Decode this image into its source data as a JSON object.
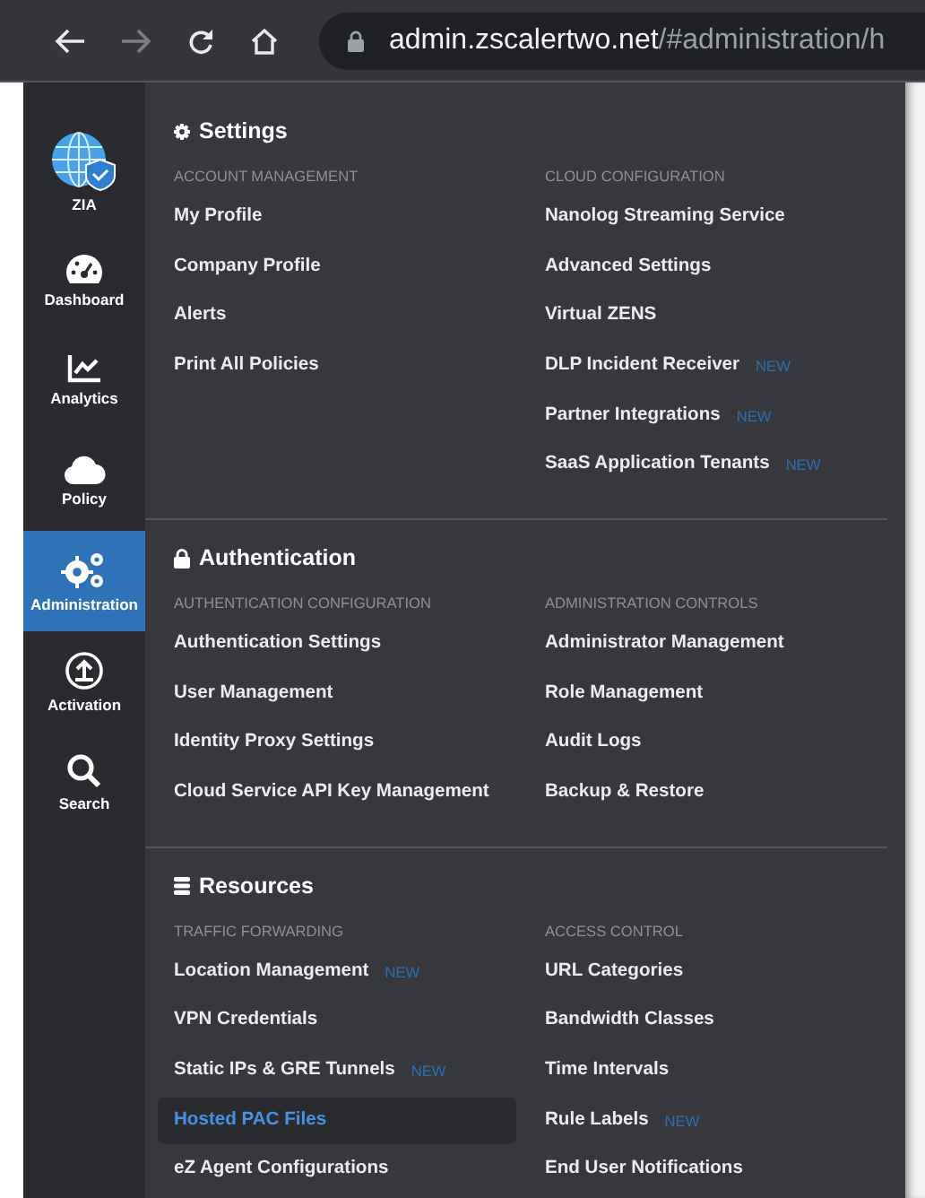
{
  "browser": {
    "nav": [
      {
        "kind": "back",
        "disabled": false
      },
      {
        "kind": "forward",
        "disabled": true
      },
      {
        "kind": "reload",
        "disabled": false
      },
      {
        "kind": "home",
        "disabled": false
      }
    ],
    "url_host": "admin.zscalertwo.net",
    "url_path": "/#administration/h"
  },
  "sidebar": {
    "items": [
      {
        "label": "ZIA",
        "selected": false
      },
      {
        "label": "Dashboard",
        "selected": false
      },
      {
        "label": "Analytics",
        "selected": false
      },
      {
        "label": "Policy",
        "selected": false
      },
      {
        "label": "Administration",
        "selected": true
      },
      {
        "label": "Activation",
        "selected": false
      },
      {
        "label": "Search",
        "selected": false
      }
    ]
  },
  "sections": [
    {
      "title": "Settings",
      "columns": [
        {
          "heading": "ACCOUNT MANAGEMENT",
          "items": [
            {
              "label": "My Profile",
              "selected": false
            },
            {
              "label": "Company Profile",
              "selected": false
            },
            {
              "label": "Alerts",
              "selected": false
            },
            {
              "label": "Print All Policies",
              "selected": false
            }
          ]
        },
        {
          "heading": "CLOUD CONFIGURATION",
          "items": [
            {
              "label": "Nanolog Streaming Service",
              "selected": false
            },
            {
              "label": "Advanced Settings",
              "selected": false
            },
            {
              "label": "Virtual ZENS",
              "selected": false
            },
            {
              "label": "DLP Incident Receiver",
              "selected": false,
              "badge": "NEW"
            },
            {
              "label": "Partner Integrations",
              "selected": false,
              "badge": "NEW"
            },
            {
              "label": "SaaS Application Tenants",
              "selected": false,
              "badge": "NEW"
            }
          ]
        }
      ]
    },
    {
      "title": "Authentication",
      "columns": [
        {
          "heading": "AUTHENTICATION CONFIGURATION",
          "items": [
            {
              "label": "Authentication Settings",
              "selected": false
            },
            {
              "label": "User Management",
              "selected": false
            },
            {
              "label": "Identity Proxy Settings",
              "selected": false
            },
            {
              "label": "Cloud Service API Key Management",
              "selected": false
            }
          ]
        },
        {
          "heading": "ADMINISTRATION CONTROLS",
          "items": [
            {
              "label": "Administrator Management",
              "selected": false
            },
            {
              "label": "Role Management",
              "selected": false
            },
            {
              "label": "Audit Logs",
              "selected": false
            },
            {
              "label": "Backup & Restore",
              "selected": false
            }
          ]
        }
      ]
    },
    {
      "title": "Resources",
      "columns": [
        {
          "heading": "TRAFFIC FORWARDING",
          "items": [
            {
              "label": "Location Management",
              "selected": false,
              "badge": "NEW"
            },
            {
              "label": "VPN Credentials",
              "selected": false
            },
            {
              "label": "Static IPs & GRE Tunnels",
              "selected": false,
              "badge": "NEW"
            },
            {
              "label": "Hosted PAC Files",
              "selected": true
            },
            {
              "label": "eZ Agent Configurations",
              "selected": false
            }
          ]
        },
        {
          "heading": "ACCESS CONTROL",
          "items": [
            {
              "label": "URL Categories",
              "selected": false
            },
            {
              "label": "Bandwidth Classes",
              "selected": false
            },
            {
              "label": "Time Intervals",
              "selected": false
            },
            {
              "label": "Rule Labels",
              "selected": false,
              "badge": "NEW"
            },
            {
              "label": "End User Notifications",
              "selected": false
            }
          ]
        }
      ]
    }
  ]
}
